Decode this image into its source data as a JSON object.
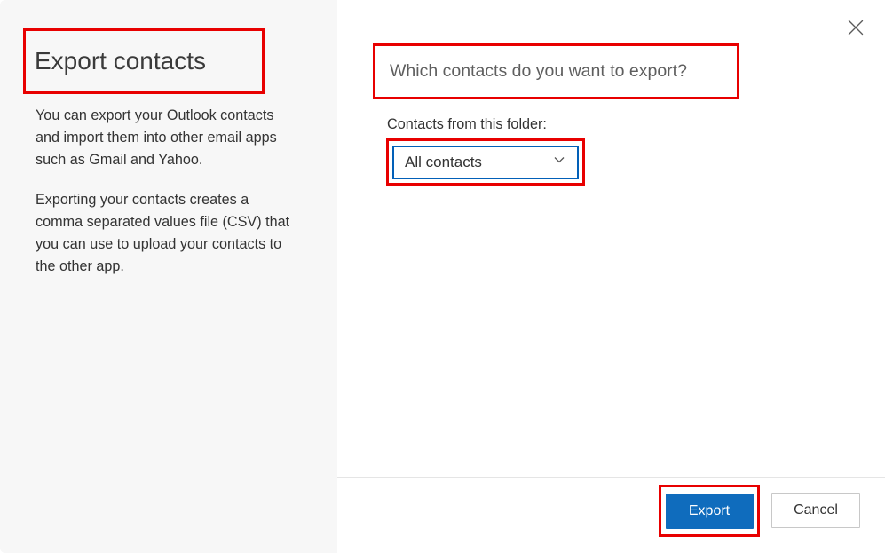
{
  "sidebar": {
    "title": "Export contacts",
    "description1": "You can export your Outlook contacts and import them into other email apps such as Gmail and Yahoo.",
    "description2": "Exporting your contacts creates a comma separated values file (CSV) that you can use to upload your contacts to the other app."
  },
  "main": {
    "question": "Which contacts do you want to export?",
    "folder_label": "Contacts from this folder:",
    "selected_folder": "All contacts"
  },
  "footer": {
    "export_label": "Export",
    "cancel_label": "Cancel"
  }
}
